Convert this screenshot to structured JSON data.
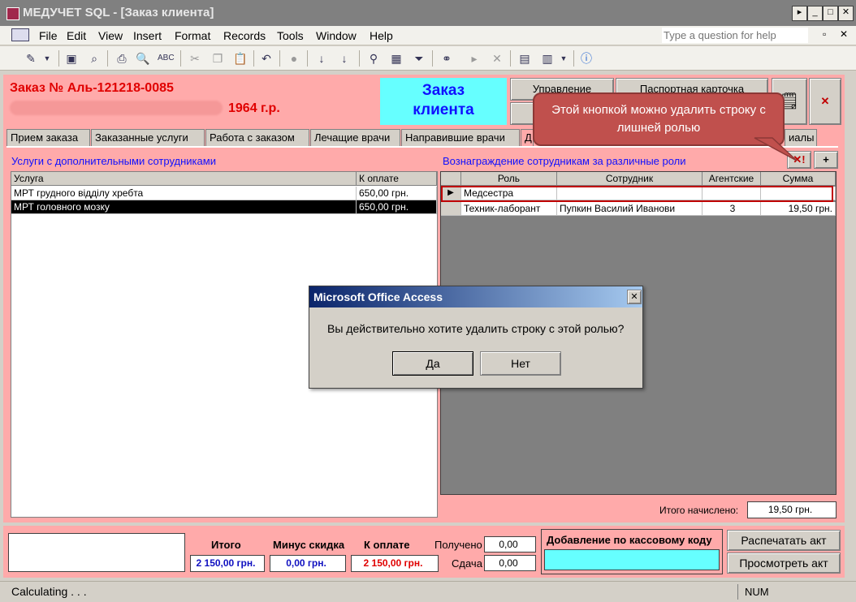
{
  "window": {
    "title": "МЕДУЧЕТ SQL - [Заказ клиента]"
  },
  "menu": [
    "File",
    "Edit",
    "View",
    "Insert",
    "Format",
    "Records",
    "Tools",
    "Window",
    "Help"
  ],
  "help_box": {
    "placeholder": "Type a question for help"
  },
  "header": {
    "order_label": "Заказ №  Аль-121218-0085",
    "year": "1964 г.р.",
    "client_title_line1": "Заказ",
    "client_title_line2": "клиента",
    "btn_manage": "Управление",
    "btn_passport": "Паспортная карточка"
  },
  "tabs": [
    "Прием заказа",
    "Заказанные услуги",
    "Работа с заказом",
    "Лечащие врачи",
    "Направившие врачи",
    "Д",
    "иалы"
  ],
  "left_section": {
    "title": "Услуги с дополнительными сотрудниками",
    "columns": [
      "Услуга",
      "К оплате"
    ],
    "rows": [
      {
        "service": "МРТ грудного відділу хребта",
        "amount": "650,00 грн."
      },
      {
        "service": "МРТ головного мозку",
        "amount": "650,00 грн."
      }
    ]
  },
  "right_section": {
    "title": "Вознаграждение сотрудникам за различные роли",
    "delete_btn": "✕!",
    "add_btn": "+",
    "columns": [
      "Роль",
      "Сотрудник",
      "Агентские",
      "Сумма"
    ],
    "rows": [
      {
        "role": "Медсестра",
        "employee": "",
        "agency": "",
        "sum": ""
      },
      {
        "role": "Техник-лаборант",
        "employee": "Пупкин Василий Иванови",
        "agency": "3",
        "sum": "19,50 грн."
      }
    ],
    "total_label": "Итого начислено:",
    "total_value": "19,50 грн."
  },
  "callout": {
    "text": "Этой кнопкой можно удалить строку с лишней ролью"
  },
  "dialog": {
    "title": "Microsoft Office Access",
    "message": "Вы действительно хотите удалить строку с этой ролью?",
    "yes": "Да",
    "no": "Нет"
  },
  "footer": {
    "itogo_label": "Итого",
    "itogo_value": "2 150,00 грн.",
    "discount_label": "Минус скидка",
    "discount_value": "0,00 грн.",
    "topay_label": "К оплате",
    "topay_value": "2 150,00 грн.",
    "received_label": "Получено",
    "received_value": "0,00",
    "change_label": "Сдача",
    "change_value": "0,00",
    "cashcode_label": "Добавление по кассовому коду",
    "print_btn": "Распечатать акт",
    "view_btn": "Просмотреть акт"
  },
  "status": {
    "text": "Calculating . . .",
    "num": "NUM"
  },
  "colors": {
    "accent_red": "#e00000",
    "pink_bg": "#ffaaaa",
    "cyan": "#66ffff",
    "callout": "#c0504d"
  }
}
